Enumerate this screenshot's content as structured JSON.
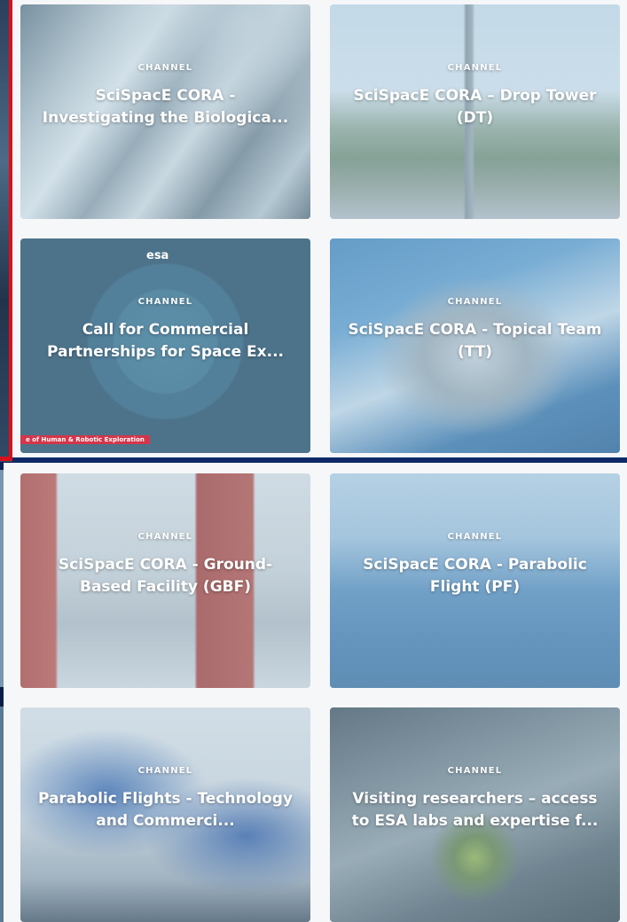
{
  "cards": [
    {
      "kicker": "CHANNEL",
      "title": "SciSpacE CORA - Investigating the Biologica..."
    },
    {
      "kicker": "CHANNEL",
      "title": "SciSpacE CORA – Drop Tower (DT)"
    },
    {
      "kicker": "CHANNEL",
      "title": "Call for Commercial Partnerships for Space Ex..."
    },
    {
      "kicker": "CHANNEL",
      "title": "SciSpacE CORA - Topical Team (TT)"
    },
    {
      "kicker": "CHANNEL",
      "title": "SciSpacE CORA - Ground-Based Facility (GBF)"
    },
    {
      "kicker": "CHANNEL",
      "title": "SciSpacE CORA - Parabolic Flight (PF)"
    },
    {
      "kicker": "CHANNEL",
      "title": "Parabolic Flights - Technology and Commerci..."
    },
    {
      "kicker": "CHANNEL",
      "title": "Visiting researchers – access to ESA labs and expertise f..."
    }
  ],
  "card3_badge": "e of Human & Robotic Exploration",
  "card3_logo": "esa",
  "colors": {
    "page_bg": "#f6f7f9",
    "band_blue": "#0e2a66",
    "frame_red": "#d6121f"
  }
}
